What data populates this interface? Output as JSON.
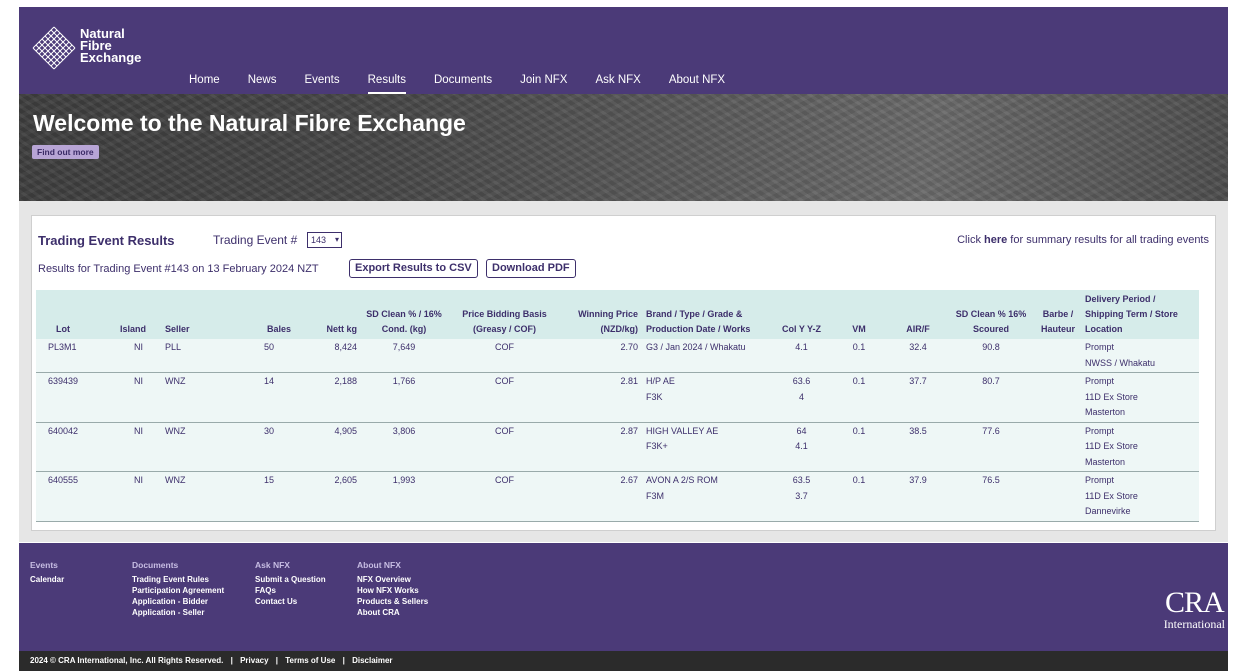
{
  "brand": {
    "logo_line1": "Natural",
    "logo_line2": "Fibre",
    "logo_line3": "Exchange"
  },
  "nav": [
    "Home",
    "News",
    "Events",
    "Results",
    "Documents",
    "Join NFX",
    "Ask NFX",
    "About NFX"
  ],
  "nav_active": "Results",
  "hero": {
    "title": "Welcome to the Natural Fibre Exchange",
    "button": "Find out more"
  },
  "results": {
    "title": "Trading Event Results",
    "trading_event_label": "Trading Event #",
    "trading_event_value": "143",
    "summary_prefix": "Click ",
    "summary_link": "here",
    "summary_suffix": " for summary results for all trading events",
    "results_for": "Results for Trading Event #143 on 13 February 2024 NZT",
    "export_csv": "Export Results to CSV",
    "download_pdf": "Download PDF"
  },
  "table": {
    "headers": [
      "Lot",
      "Island",
      "Seller",
      "Bales",
      "Nett kg",
      "SD Clean % / 16% Cond. (kg)",
      "Price Bidding Basis (Greasy / COF)",
      "Winning Price (NZD/kg)",
      "Brand / Type / Grade & Production Date / Works",
      "Col Y Y-Z",
      "VM",
      "AIR/F",
      "SD Clean % 16% Scoured",
      "Barbe / Hauteur",
      "Delivery Period / Shipping Term / Store Location"
    ],
    "rows": [
      {
        "lot": "PL3M1",
        "island": "NI",
        "seller": "PLL",
        "bales": "50",
        "nett": "8,424",
        "sdclean": "7,649",
        "basis": "COF",
        "price": "2.70",
        "brand1": "G3 / Jan 2024 / Whakatu",
        "brand2": "",
        "col1": "4.1",
        "col2": "",
        "vm": "0.1",
        "air": "32.4",
        "scoured": "90.8",
        "barbe": "",
        "del1": "Prompt",
        "del2": "NWSS / Whakatu",
        "del3": ""
      },
      {
        "lot": "639439",
        "island": "NI",
        "seller": "WNZ",
        "bales": "14",
        "nett": "2,188",
        "sdclean": "1,766",
        "basis": "COF",
        "price": "2.81",
        "brand1": "H/P AE",
        "brand2": "F3K",
        "col1": "63.6",
        "col2": "4",
        "vm": "0.1",
        "air": "37.7",
        "scoured": "80.7",
        "barbe": "",
        "del1": "Prompt",
        "del2": "11D Ex Store",
        "del3": "Masterton"
      },
      {
        "lot": "640042",
        "island": "NI",
        "seller": "WNZ",
        "bales": "30",
        "nett": "4,905",
        "sdclean": "3,806",
        "basis": "COF",
        "price": "2.87",
        "brand1": "HIGH VALLEY AE",
        "brand2": "F3K+",
        "col1": "64",
        "col2": "4.1",
        "vm": "0.1",
        "air": "38.5",
        "scoured": "77.6",
        "barbe": "",
        "del1": "Prompt",
        "del2": "11D Ex Store",
        "del3": "Masterton"
      },
      {
        "lot": "640555",
        "island": "NI",
        "seller": "WNZ",
        "bales": "15",
        "nett": "2,605",
        "sdclean": "1,993",
        "basis": "COF",
        "price": "2.67",
        "brand1": "AVON A 2/S ROM",
        "brand2": "F3M",
        "col1": "63.5",
        "col2": "3.7",
        "vm": "0.1",
        "air": "37.9",
        "scoured": "76.5",
        "barbe": "",
        "del1": "Prompt",
        "del2": "11D Ex Store",
        "del3": "Dannevirke"
      }
    ]
  },
  "footer": {
    "events": {
      "heading": "Events",
      "items": [
        "Calendar"
      ]
    },
    "documents": {
      "heading": "Documents",
      "items": [
        "Trading Event Rules",
        "Participation Agreement",
        "Application - Bidder",
        "Application - Seller"
      ]
    },
    "ask": {
      "heading": "Ask NFX",
      "items": [
        "Submit a Question",
        "FAQs",
        "Contact Us"
      ]
    },
    "about": {
      "heading": "About NFX",
      "items": [
        "NFX Overview",
        "How NFX Works",
        "Products & Sellers",
        "About CRA"
      ]
    },
    "cra_big": "CRA",
    "cra_small": "International",
    "copyright": "2024 © CRA International, Inc. All Rights Reserved.",
    "links": [
      "Privacy",
      "Terms of Use",
      "Disclaimer"
    ]
  },
  "colors": {
    "header": "#4b3a78",
    "accent_text": "#3d2f6b",
    "table_head": "#d6ecea",
    "table_row": "#eef7f6"
  }
}
